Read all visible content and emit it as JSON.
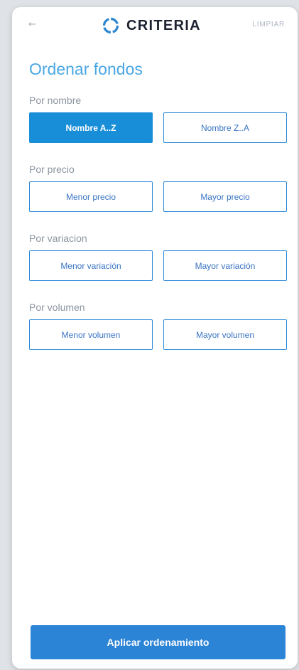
{
  "header": {
    "back_icon": "←",
    "brand_name": "CRITERIA",
    "clear_label": "LIMPIAR"
  },
  "page_title": "Ordenar fondos",
  "sections": [
    {
      "label": "Por nombre",
      "options": [
        {
          "label": "Nombre A..Z",
          "selected": true
        },
        {
          "label": "Nombre Z..A",
          "selected": false
        }
      ]
    },
    {
      "label": "Por precio",
      "options": [
        {
          "label": "Menor precio",
          "selected": false
        },
        {
          "label": "Mayor precio",
          "selected": false
        }
      ]
    },
    {
      "label": "Por variacion",
      "options": [
        {
          "label": "Menor variación",
          "selected": false
        },
        {
          "label": "Mayor variación",
          "selected": false
        }
      ]
    },
    {
      "label": "Por volumen",
      "options": [
        {
          "label": "Menor volumen",
          "selected": false
        },
        {
          "label": "Mayor volumen",
          "selected": false
        }
      ]
    }
  ],
  "apply_button": "Aplicar ordenamiento",
  "colors": {
    "accent": "#198ed8",
    "title": "#49a7e4",
    "label": "#8c94a0",
    "brand_dark": "#1d2330",
    "brand_ring": "#2a86d1"
  },
  "icons": {
    "back": "arrow-left-icon",
    "brand": "criteria-logo-ring-icon"
  }
}
